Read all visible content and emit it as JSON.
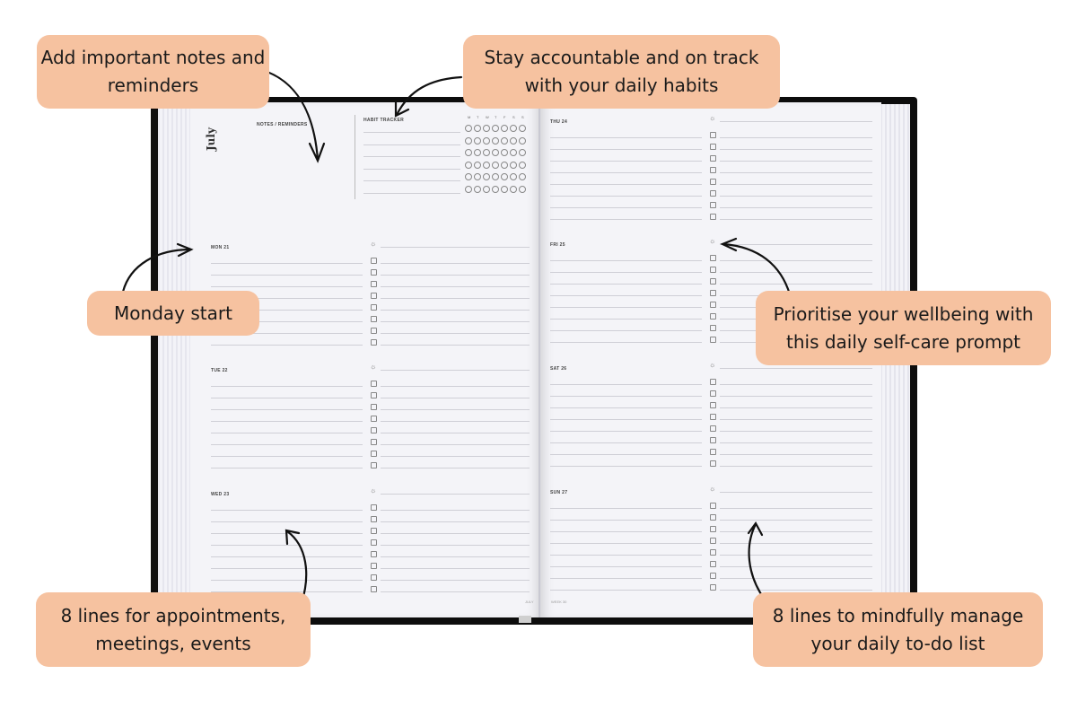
{
  "planner": {
    "month": "July",
    "notes_label": "NOTES / REMINDERS",
    "habit_label": "HABIT TRACKER",
    "habit_days": [
      "M",
      "T",
      "W",
      "T",
      "F",
      "S",
      "S"
    ],
    "habit_rows": 6,
    "lines_per_day": 8,
    "left_days": [
      "MON 21",
      "TUE 22",
      "WED 23"
    ],
    "right_days": [
      "THU 24",
      "FRI 25",
      "SAT 26",
      "SUN 27"
    ],
    "footer_left": "JULY",
    "footer_right": "WEEK 30",
    "icons": {
      "self_care": "sun-icon",
      "todo": "checkbox-icon",
      "habit": "circle-icon"
    }
  },
  "callouts": {
    "notes": "Add important notes and reminders",
    "habits": "Stay accountable and on track with your daily habits",
    "monday": "Monday start",
    "selfcare": "Prioritise your wellbeing with this daily self-care prompt",
    "appointments": "8 lines for appointments, meetings, events",
    "todo": "8 lines to mindfully manage your daily to-do list"
  },
  "colors": {
    "callout_bg": "#f6c2a0",
    "cover": "#0d0d0d",
    "page": "#f4f4f8"
  }
}
